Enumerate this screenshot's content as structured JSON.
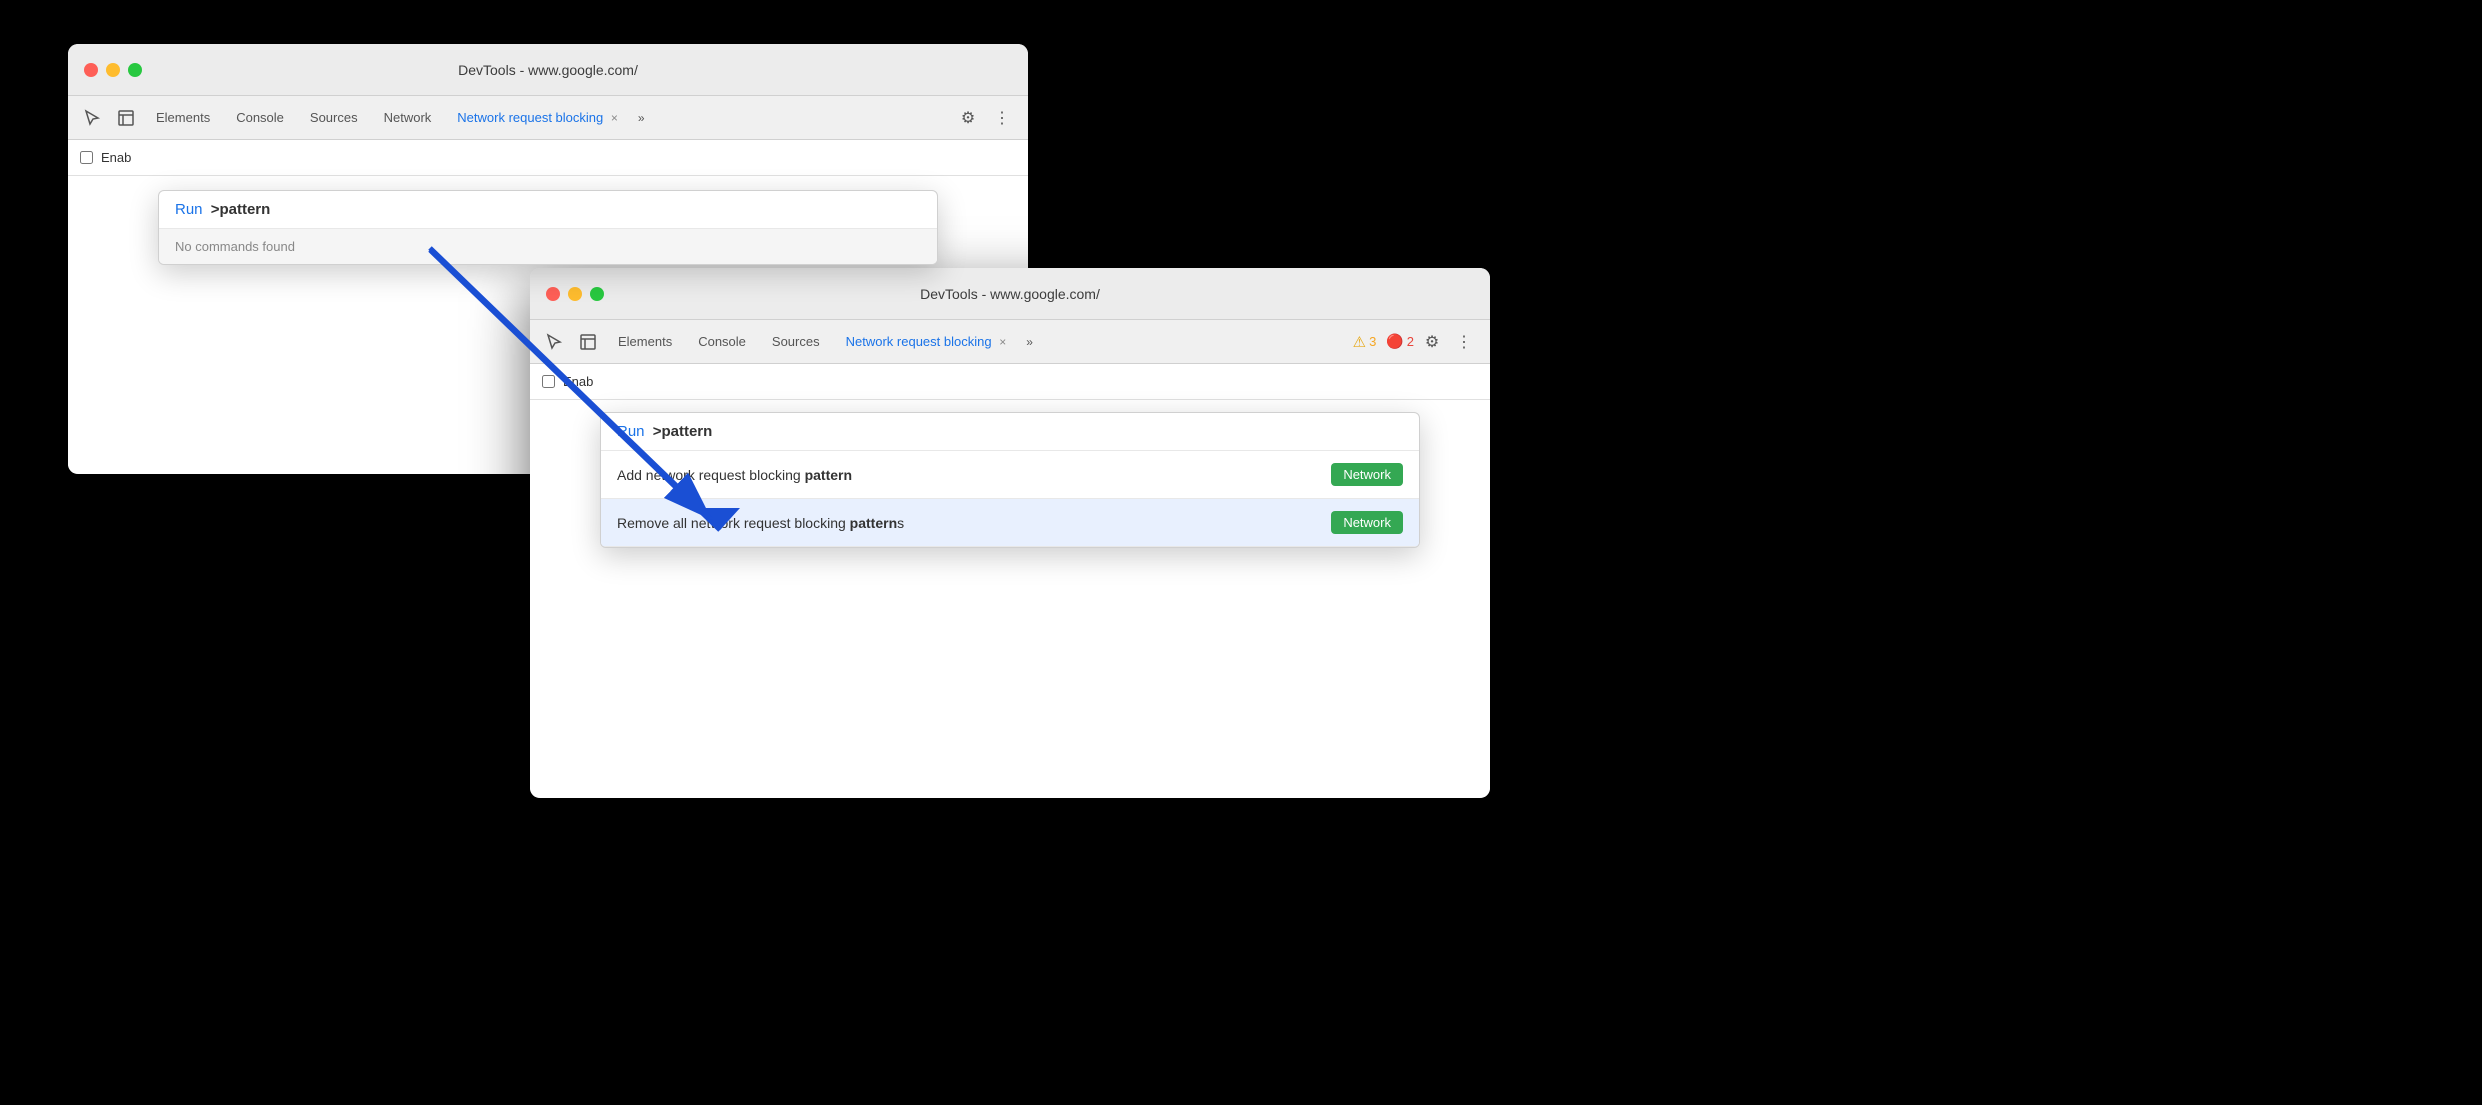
{
  "window1": {
    "title": "DevTools - www.google.com/",
    "tabs": [
      {
        "label": "Elements",
        "active": false
      },
      {
        "label": "Console",
        "active": false
      },
      {
        "label": "Sources",
        "active": false
      },
      {
        "label": "Network",
        "active": false
      },
      {
        "label": "Network request blocking",
        "active": true
      },
      {
        "label": "»",
        "active": false
      }
    ],
    "cmd_palette": {
      "run_label": "Run",
      "prompt": ">pattern",
      "no_results": "No commands found"
    },
    "enable_label": "Enab"
  },
  "window2": {
    "title": "DevTools - www.google.com/",
    "tabs": [
      {
        "label": "Elements",
        "active": false
      },
      {
        "label": "Console",
        "active": false
      },
      {
        "label": "Sources",
        "active": false
      },
      {
        "label": "Network request blocking",
        "active": true
      },
      {
        "label": "»",
        "active": false
      }
    ],
    "warn_count": "3",
    "err_count": "2",
    "cmd_palette": {
      "run_label": "Run",
      "prompt": ">pattern",
      "results": [
        {
          "text_normal": "Add network request blocking ",
          "text_bold": "pattern",
          "badge": "Network",
          "selected": false
        },
        {
          "text_normal": "Remove all network request blocking ",
          "text_bold": "patterns",
          "text_suffix": "s",
          "badge": "Network",
          "selected": true
        }
      ]
    },
    "enable_label": "Enab"
  },
  "icons": {
    "cursor": "⬡",
    "inspect": "⬜",
    "gear": "⚙",
    "more": "⋮",
    "warn_icon": "⚠",
    "err_icon": "🔔"
  }
}
